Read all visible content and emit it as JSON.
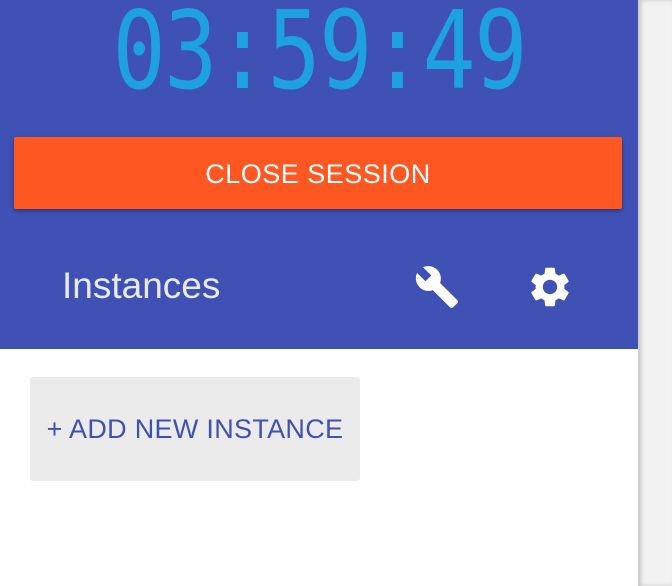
{
  "session": {
    "timer": "03:59:49",
    "close_label": "CLOSE SESSION"
  },
  "instances": {
    "title": "Instances",
    "settings_icon": "wrench-icon",
    "preferences_icon": "gear-icon",
    "add_label": "+ ADD NEW INSTANCE"
  },
  "colors": {
    "header_bg": "#3f51b5",
    "timer": "#1da1e2",
    "close_button": "#ff5722",
    "add_button_bg": "#ebebeb",
    "add_button_text": "#3f51b5"
  }
}
